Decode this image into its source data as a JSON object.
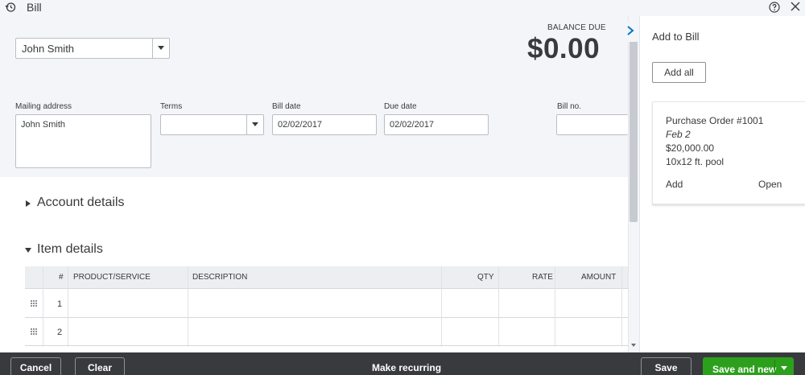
{
  "window": {
    "title": "Bill"
  },
  "colors": {
    "accent": "#2ca01c",
    "footer": "#393a3d",
    "panel": "#f4f5f8"
  },
  "vendor": {
    "value": "John Smith"
  },
  "balance": {
    "label": "BALANCE DUE",
    "value": "$0.00"
  },
  "fields": {
    "mailing_address": {
      "label": "Mailing address",
      "value": "John Smith"
    },
    "terms": {
      "label": "Terms",
      "value": ""
    },
    "bill_date": {
      "label": "Bill date",
      "value": "02/02/2017"
    },
    "due_date": {
      "label": "Due date",
      "value": "02/02/2017"
    },
    "bill_no": {
      "label": "Bill no.",
      "value": ""
    }
  },
  "sections": {
    "account_details": "Account details",
    "item_details": "Item details"
  },
  "item_table": {
    "columns": [
      "#",
      "PRODUCT/SERVICE",
      "DESCRIPTION",
      "QTY",
      "RATE",
      "AMOUNT"
    ],
    "rows": [
      {
        "num": "1"
      },
      {
        "num": "2"
      }
    ]
  },
  "drawer": {
    "title": "Add to Bill",
    "add_all": "Add all",
    "card": {
      "title": "Purchase Order #1001",
      "date": "Feb 2",
      "amount": "$20,000.00",
      "description": "10x12 ft. pool",
      "add": "Add",
      "open": "Open"
    }
  },
  "footer": {
    "cancel": "Cancel",
    "clear": "Clear",
    "make_recurring": "Make recurring",
    "save": "Save",
    "save_and_new": "Save and new"
  },
  "icons": {
    "history": "history-icon",
    "help": "help-icon",
    "close": "close-icon",
    "collapse": "chevron-right-icon"
  }
}
